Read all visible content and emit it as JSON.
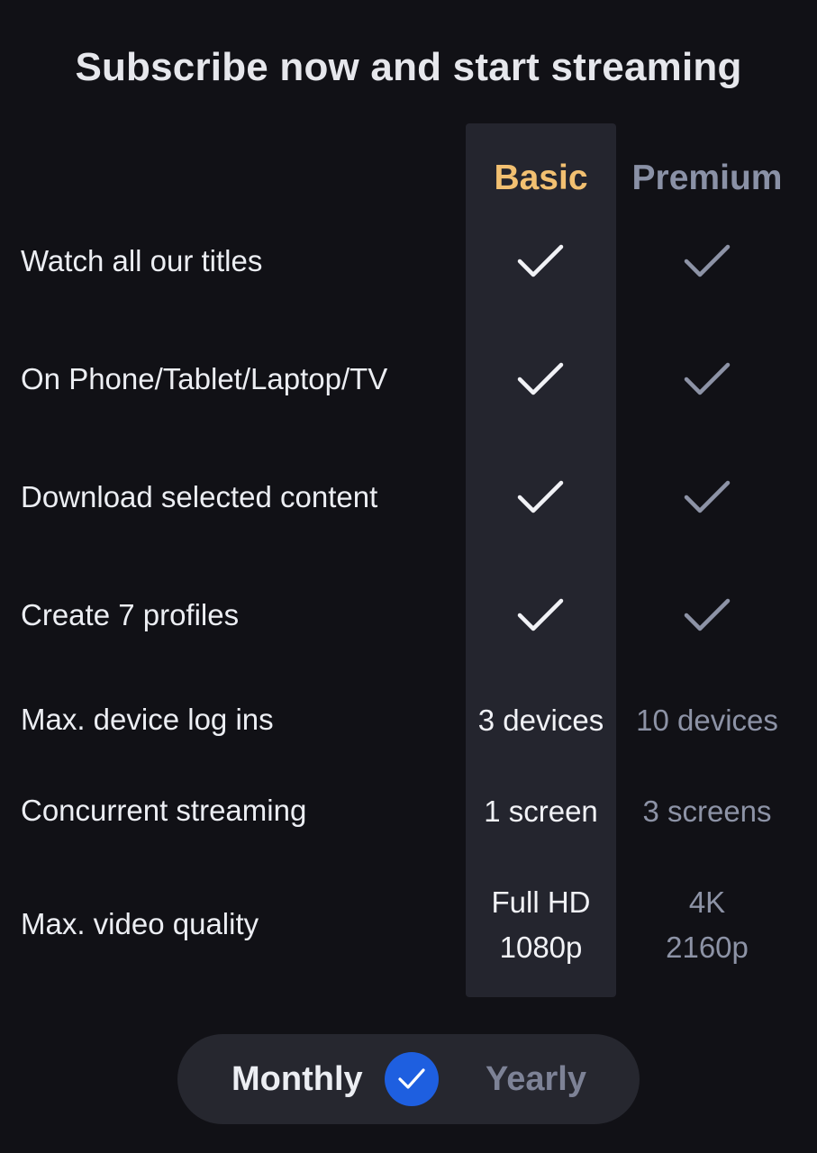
{
  "title": "Subscribe now and start streaming",
  "plans": {
    "basic": {
      "name": "Basic",
      "color": "#f2c071"
    },
    "premium": {
      "name": "Premium",
      "color": "#8a91a6"
    }
  },
  "features": [
    {
      "label": "Watch all our titles",
      "basic": true,
      "premium": true
    },
    {
      "label": "On Phone/Tablet/Laptop/TV",
      "basic": true,
      "premium": true
    },
    {
      "label": "Download selected content",
      "basic": true,
      "premium": true
    },
    {
      "label": "Create 7 profiles",
      "basic": true,
      "premium": true
    },
    {
      "label": "Max. device log ins",
      "basic": "3 devices",
      "premium": "10 devices"
    },
    {
      "label": "Concurrent streaming",
      "basic": "1 screen",
      "premium": "3 screens"
    },
    {
      "label": "Max. video quality",
      "basic_line1": "Full HD",
      "basic_line2": "1080p",
      "premium_line1": "4K",
      "premium_line2": "2160p"
    }
  ],
  "billing_toggle": {
    "monthly_label": "Monthly",
    "yearly_label": "Yearly",
    "selected": "Monthly",
    "accent": "#1e5fe0"
  },
  "icons": {
    "included": "checkmark-icon",
    "selected": "check-circle-icon"
  }
}
